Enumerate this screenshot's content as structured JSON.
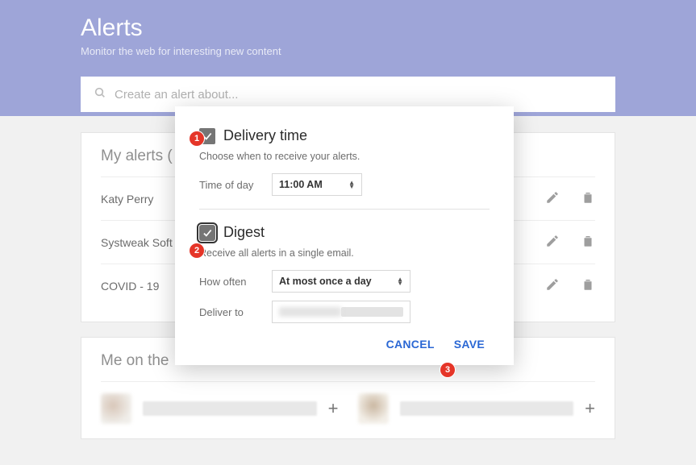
{
  "header": {
    "title": "Alerts",
    "subtitle": "Monitor the web for interesting new content"
  },
  "search": {
    "placeholder": "Create an alert about..."
  },
  "my_alerts": {
    "heading": "My alerts (",
    "items": [
      "Katy Perry",
      "Systweak Soft",
      "COVID - 19"
    ]
  },
  "me_on_web": {
    "heading": "Me on the"
  },
  "dialog": {
    "delivery_time": {
      "label": "Delivery time",
      "desc": "Choose when to receive your alerts.",
      "time_label": "Time of day",
      "time_value": "11:00 AM"
    },
    "digest": {
      "label": "Digest",
      "desc": "Receive all alerts in a single email.",
      "how_often_label": "How often",
      "how_often_value": "At most once a day",
      "deliver_to_label": "Deliver to"
    },
    "actions": {
      "cancel": "CANCEL",
      "save": "SAVE"
    }
  },
  "badges": [
    "1",
    "2",
    "3"
  ]
}
